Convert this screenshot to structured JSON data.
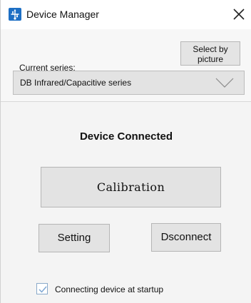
{
  "window": {
    "title": "Device Manager",
    "icon": "usb-icon",
    "close_icon": "close-icon"
  },
  "series": {
    "label": "Current series:",
    "select_by_picture_label": "Select by picture",
    "selected_value": "DB Infrared/Capacitive series",
    "chevron_icon": "chevron-down-icon"
  },
  "status": {
    "text": "Device Connected"
  },
  "buttons": {
    "calibration_label": "Calibration",
    "setting_label": "Setting",
    "disconnect_label": "Dsconnect"
  },
  "startup": {
    "label": "Connecting device at startup",
    "checked": true
  },
  "colors": {
    "accent": "#1d6fc4",
    "window_bg": "#f4f4f4",
    "button_bg": "#e3e3e3"
  }
}
